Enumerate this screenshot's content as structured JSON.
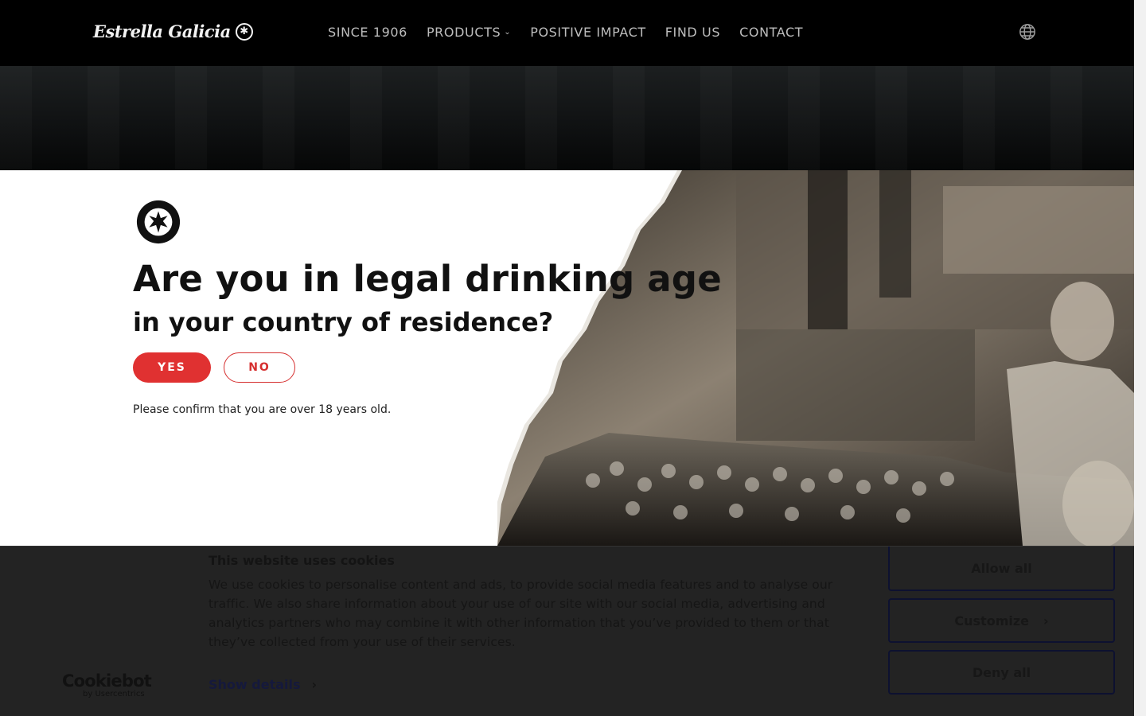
{
  "header": {
    "logo_text": "Estrella Galicia",
    "logo_badge_icon": "star-badge-icon",
    "nav": [
      {
        "label": "SINCE 1906"
      },
      {
        "label": "PRODUCTS",
        "has_dropdown": true
      },
      {
        "label": "POSITIVE IMPACT"
      },
      {
        "label": "FIND US"
      },
      {
        "label": "CONTACT"
      }
    ],
    "language_icon": "globe-icon"
  },
  "age_gate": {
    "seal_icon": "estrella-galicia-seal-icon",
    "title": "Are you in legal drinking age",
    "subtitle": "in your country of residence?",
    "yes_label": "YES",
    "no_label": "NO",
    "note": "Please confirm that you are over 18 years old.",
    "colors": {
      "accent": "#e03131"
    }
  },
  "cookie_banner": {
    "title": "This website uses cookies",
    "body": "We use cookies to personalise content and ads, to provide social media features and to analyse our traffic. We also share information about your use of our site with our social media, advertising and analytics partners who may combine it with other information that you’ve provided to them or that they’ve collected from your use of their services.",
    "show_details_label": "Show details",
    "brand_name": "Cookiebot",
    "brand_by": "by Usercentrics",
    "allow_all_label": "Allow all",
    "customize_label": "Customize",
    "deny_all_label": "Deny all"
  }
}
